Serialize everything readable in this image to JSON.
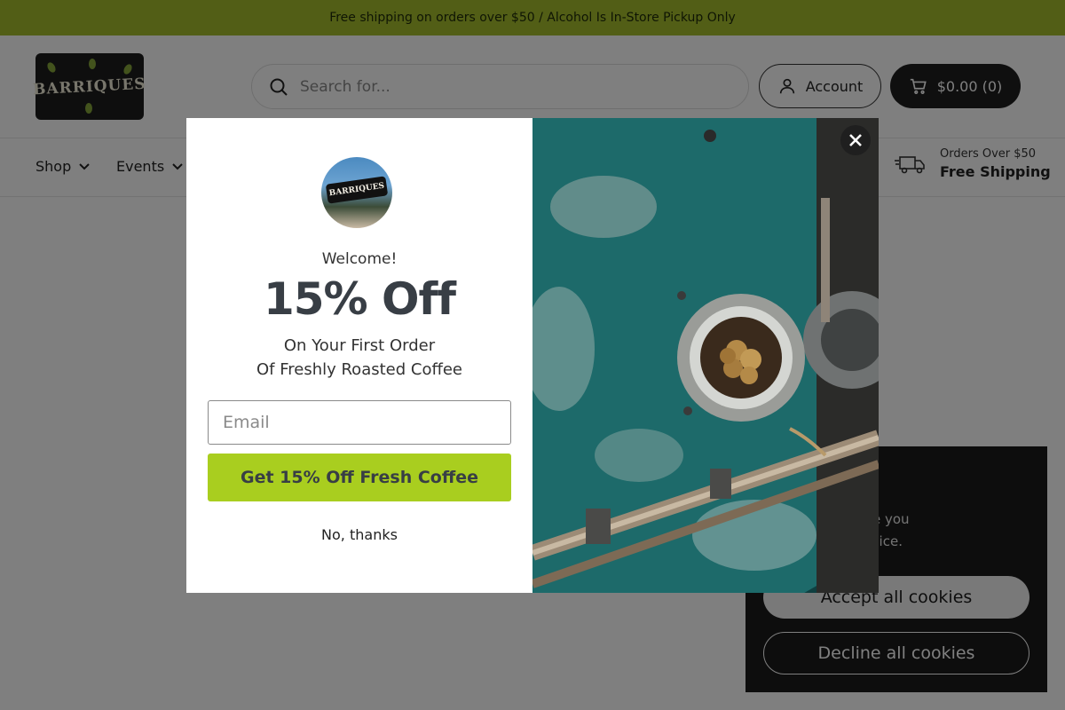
{
  "announcement": "Free shipping on orders over $50 / Alcohol Is In-Store Pickup Only",
  "logo_text": "BARRIQUES",
  "search": {
    "placeholder": "Search for..."
  },
  "header": {
    "account_label": "Account",
    "cart_label": "$0.00 (0)"
  },
  "nav": {
    "items": [
      {
        "label": "Shop"
      },
      {
        "label": "Events"
      }
    ]
  },
  "shipping_promo": {
    "line1": "Orders Over $50",
    "line2": "Free Shipping"
  },
  "popup": {
    "logo_text": "BARRIQUES",
    "welcome": "Welcome!",
    "offer": "15% Off",
    "subtitle_line1": "On Your First Order",
    "subtitle_line2": "Of Freshly Roasted Coffee",
    "email_placeholder": "Email",
    "cta_label": "Get 15% Off Fresh Coffee",
    "decline_label": "No, thanks"
  },
  "cookie_banner": {
    "text": "cookies to ensure you\nence on your device.",
    "accept_label": "Accept all cookies",
    "decline_label": "Decline all cookies"
  },
  "colors": {
    "accent": "#a4bd2c",
    "cta": "#a9ce1f",
    "dark": "#1f1f1f"
  },
  "icons": [
    "search-icon",
    "user-icon",
    "cart-icon",
    "chevron-down-icon",
    "truck-icon",
    "close-icon"
  ]
}
